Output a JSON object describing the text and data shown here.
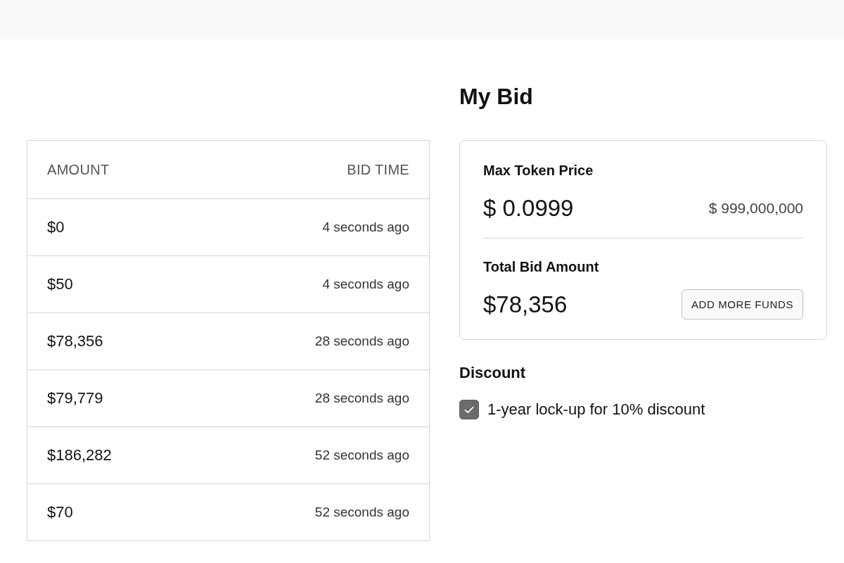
{
  "my_bid": {
    "title": "My Bid",
    "max_token_price": {
      "label": "Max Token Price",
      "value": "$ 0.0999",
      "total": "$ 999,000,000"
    },
    "total_bid_amount": {
      "label": "Total Bid Amount",
      "value": "$78,356",
      "button": "ADD MORE FUNDS"
    }
  },
  "bids_table": {
    "columns": [
      "AMOUNT",
      "BID TIME"
    ],
    "rows": [
      {
        "amount": "$0",
        "bid_time": "4 seconds ago"
      },
      {
        "amount": "$50",
        "bid_time": "4 seconds ago"
      },
      {
        "amount": "$78,356",
        "bid_time": "28 seconds ago"
      },
      {
        "amount": "$79,779",
        "bid_time": "28 seconds ago"
      },
      {
        "amount": "$186,282",
        "bid_time": "52 seconds ago"
      },
      {
        "amount": "$70",
        "bid_time": "52 seconds ago"
      }
    ]
  },
  "discount": {
    "title": "Discount",
    "option": {
      "label": "1-year lock-up for 10% discount",
      "checked": true
    }
  }
}
